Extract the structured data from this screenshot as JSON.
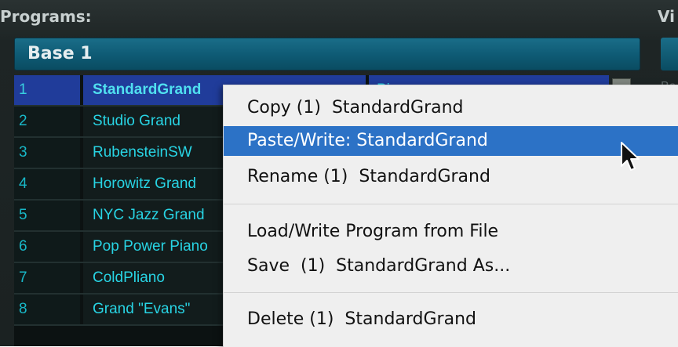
{
  "header": {
    "programs_label": "Programs:",
    "right_label": "Vi"
  },
  "bank": {
    "label": "Base 1"
  },
  "programs": [
    {
      "num": "1",
      "name": "StandardGrand",
      "category": "Piano",
      "selected": true
    },
    {
      "num": "2",
      "name": "Studio Grand",
      "category": ""
    },
    {
      "num": "3",
      "name": "RubensteinSW",
      "category": ""
    },
    {
      "num": "4",
      "name": "Horowitz Grand",
      "category": ""
    },
    {
      "num": "5",
      "name": "NYC Jazz Grand",
      "category": ""
    },
    {
      "num": "6",
      "name": "Pop Power Piano",
      "category": ""
    },
    {
      "num": "7",
      "name": "ColdPliano",
      "category": ""
    },
    {
      "num": "8",
      "name": "Grand \"Evans\"",
      "category": ""
    }
  ],
  "right_panel": {
    "text": "Ba"
  },
  "context_menu": {
    "items": [
      {
        "label": "Copy (1)  StandardGrand"
      },
      {
        "label": "Paste/Write: StandardGrand",
        "highlighted": true
      },
      {
        "label": "Rename (1)  StandardGrand"
      },
      {
        "label": "Load/Write Program from File"
      },
      {
        "label": "Save  (1)  StandardGrand As..."
      },
      {
        "label": "Delete (1)  StandardGrand"
      }
    ]
  },
  "icons": {
    "cursor": "arrow-cursor-icon",
    "scroll": "scroll-thumb"
  },
  "colors": {
    "background": "#1b2222",
    "bank_bar": "#0e5a74",
    "selected_row": "#203c9a",
    "program_text": "#28d4e4",
    "menu_background": "#efefef",
    "menu_highlight": "#2c72c6"
  }
}
